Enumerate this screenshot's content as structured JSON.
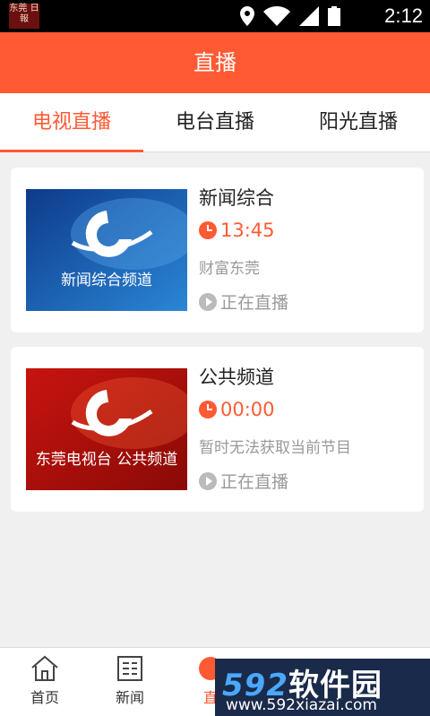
{
  "status_bar": {
    "app_icon_text": "东莞 日報",
    "time": "2:12"
  },
  "header": {
    "title": "直播"
  },
  "tabs": [
    {
      "label": "电视直播",
      "active": true
    },
    {
      "label": "电台直播",
      "active": false
    },
    {
      "label": "阳光直播",
      "active": false
    }
  ],
  "channels": [
    {
      "thumb_caption": "新闻综合频道",
      "name": "新闻综合",
      "time": "13:45",
      "program": "财富东莞",
      "status": "正在直播"
    },
    {
      "thumb_caption": "东莞电视台 公共频道",
      "name": "公共频道",
      "time": "00:00",
      "program": "暂时无法获取当前节目",
      "status": "正在直播"
    }
  ],
  "bottom_nav": [
    {
      "label": "首页",
      "icon": "home-icon"
    },
    {
      "label": "新闻",
      "icon": "news-icon"
    },
    {
      "label": "直",
      "icon": "live-icon",
      "active": true
    }
  ],
  "watermark": {
    "title": "592软件园",
    "url": "www.592xiazai.com"
  },
  "colors": {
    "accent": "#ff5a33",
    "status_bar": "#000000"
  }
}
